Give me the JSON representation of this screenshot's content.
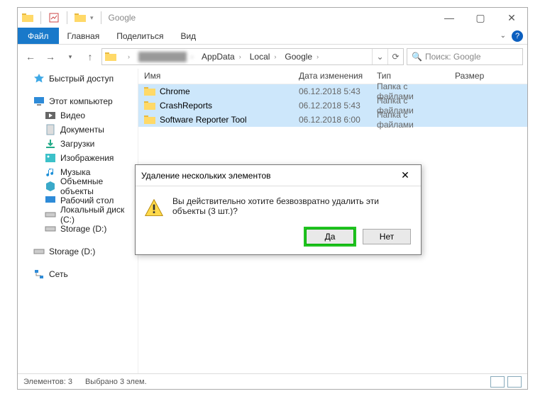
{
  "titlebar": {
    "title": "Google"
  },
  "ribbon": {
    "file": "Файл",
    "tabs": [
      "Главная",
      "Поделиться",
      "Вид"
    ]
  },
  "address": {
    "segmentsVisible": [
      "AppData",
      "Local",
      "Google"
    ],
    "refreshGlyph": "⟳",
    "dropdownGlyph": "⌄"
  },
  "search": {
    "placeholder": "Поиск: Google"
  },
  "sidebar": {
    "quick": "Быстрый доступ",
    "thispc": "Этот компьютер",
    "items": [
      {
        "label": "Видео"
      },
      {
        "label": "Документы"
      },
      {
        "label": "Загрузки"
      },
      {
        "label": "Изображения"
      },
      {
        "label": "Музыка"
      },
      {
        "label": "Объемные объекты"
      },
      {
        "label": "Рабочий стол"
      },
      {
        "label": "Локальный диск (C:)"
      },
      {
        "label": "Storage (D:)"
      }
    ],
    "storage2": "Storage (D:)",
    "network": "Сеть"
  },
  "columns": {
    "name": "Имя",
    "date": "Дата изменения",
    "type": "Тип",
    "size": "Размер"
  },
  "rows": [
    {
      "name": "Chrome",
      "date": "06.12.2018 5:43",
      "type": "Папка с файлами"
    },
    {
      "name": "CrashReports",
      "date": "06.12.2018 5:43",
      "type": "Папка с файлами"
    },
    {
      "name": "Software Reporter Tool",
      "date": "06.12.2018 6:00",
      "type": "Папка с файлами"
    }
  ],
  "status": {
    "count": "Элементов: 3",
    "selected": "Выбрано 3 элем."
  },
  "dialog": {
    "title": "Удаление нескольких элементов",
    "message": "Вы действительно хотите безвозвратно удалить эти объекты (3 шт.)?",
    "yes": "Да",
    "no": "Нет"
  }
}
